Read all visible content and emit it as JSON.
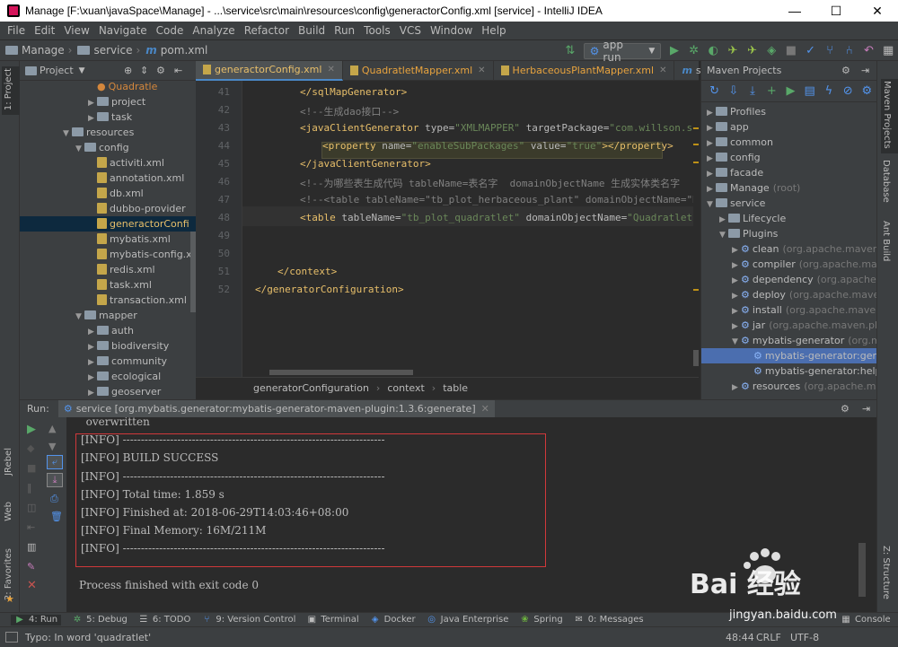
{
  "window": {
    "title": "Manage [F:\\xuan\\javaSpace\\Manage] - ...\\service\\src\\main\\resources\\config\\generactorConfig.xml [service] - IntelliJ IDEA",
    "minimize": "—",
    "maximize": "☐",
    "close": "✕"
  },
  "menu": [
    "File",
    "Edit",
    "View",
    "Navigate",
    "Code",
    "Analyze",
    "Refactor",
    "Build",
    "Run",
    "Tools",
    "VCS",
    "Window",
    "Help"
  ],
  "navbar": {
    "crumbs": [
      "Manage",
      "service",
      "pom.xml"
    ],
    "run_config": "app run"
  },
  "project_panel": {
    "title": "Project",
    "items": [
      {
        "label": "Quadratle",
        "type": "file-class"
      },
      {
        "label": "project",
        "type": "folder"
      },
      {
        "label": "task",
        "type": "folder"
      },
      {
        "label": "resources",
        "type": "folder"
      },
      {
        "label": "config",
        "type": "folder"
      },
      {
        "label": "activiti.xml",
        "type": "file"
      },
      {
        "label": "annotation.xml",
        "type": "file"
      },
      {
        "label": "db.xml",
        "type": "file"
      },
      {
        "label": "dubbo-provider",
        "type": "file"
      },
      {
        "label": "generactorConfi",
        "type": "file"
      },
      {
        "label": "mybatis.xml",
        "type": "file"
      },
      {
        "label": "mybatis-config.x",
        "type": "file"
      },
      {
        "label": "redis.xml",
        "type": "file"
      },
      {
        "label": "task.xml",
        "type": "file"
      },
      {
        "label": "transaction.xml",
        "type": "file"
      },
      {
        "label": "mapper",
        "type": "folder"
      },
      {
        "label": "auth",
        "type": "folder"
      },
      {
        "label": "biodiversity",
        "type": "folder"
      },
      {
        "label": "community",
        "type": "folder"
      },
      {
        "label": "ecological",
        "type": "folder"
      },
      {
        "label": "geoserver",
        "type": "folder"
      }
    ]
  },
  "left_strip": [
    "1: Project"
  ],
  "editor": {
    "tabs": [
      {
        "label": "generactorConfig.xml",
        "active": true
      },
      {
        "label": "QuadratletMapper.xml",
        "active": false
      },
      {
        "label": "HerbaceousPlantMapper.xml",
        "active": false
      },
      {
        "label": "service",
        "active": false
      }
    ],
    "line_numbers": [
      "41",
      "42",
      "43",
      "44",
      "45",
      "46",
      "47",
      "48",
      "49",
      "50",
      "51",
      "52"
    ],
    "lines": [
      {
        "indent": 2,
        "parts": [
          {
            "c": "tag",
            "t": "</sqlMapGenerator>"
          }
        ]
      },
      {
        "indent": 2,
        "parts": [
          {
            "c": "cmt",
            "t": "<!--生成dao接口-->"
          }
        ]
      },
      {
        "indent": 2,
        "parts": [
          {
            "c": "tag",
            "t": "<javaClientGenerator "
          },
          {
            "c": "attr",
            "t": "type="
          },
          {
            "c": "val",
            "t": "\"XMLMAPPER\" "
          },
          {
            "c": "attr",
            "t": "targetPackage="
          },
          {
            "c": "val",
            "t": "\"com.willson.serv"
          }
        ]
      },
      {
        "indent": 3,
        "parts": [
          {
            "c": "tag",
            "t": "<property "
          },
          {
            "c": "attr",
            "t": "name="
          },
          {
            "c": "val",
            "t": "\"enableSubPackages\" "
          },
          {
            "c": "attr",
            "t": "value="
          },
          {
            "c": "val",
            "t": "\"true\""
          },
          {
            "c": "tag",
            "t": "></property>"
          }
        ]
      },
      {
        "indent": 2,
        "parts": [
          {
            "c": "tag",
            "t": "</javaClientGenerator>"
          }
        ]
      },
      {
        "indent": 2,
        "parts": [
          {
            "c": "cmt",
            "t": "<!--为哪些表生成代码 tableName=表名字  domainObjectName 生成实体类名字"
          }
        ]
      },
      {
        "indent": 2,
        "parts": [
          {
            "c": "cmt",
            "t": "<!--<table tableName=\"tb_plot_herbaceous_plant\" domainObjectName=\"Her"
          }
        ]
      },
      {
        "indent": 2,
        "parts": [
          {
            "c": "tag",
            "t": "<table "
          },
          {
            "c": "attr",
            "t": "tableName="
          },
          {
            "c": "val",
            "t": "\"tb_plot_quadratlet\" "
          },
          {
            "c": "attr",
            "t": "domainObjectName="
          },
          {
            "c": "val",
            "t": "\"Quadratlet\" "
          },
          {
            "c": "tag",
            "t": "/"
          }
        ]
      },
      {
        "indent": 0,
        "parts": []
      },
      {
        "indent": 0,
        "parts": []
      },
      {
        "indent": 1,
        "parts": [
          {
            "c": "tag",
            "t": "</context>"
          }
        ]
      },
      {
        "indent": 0,
        "parts": [
          {
            "c": "tag",
            "t": "</generatorConfiguration>"
          }
        ]
      }
    ],
    "breadcrumbs": [
      "generatorConfiguration",
      "context",
      "table"
    ]
  },
  "maven_panel": {
    "title": "Maven Projects",
    "items": [
      {
        "label": "Profiles",
        "sub": "",
        "depth": 0,
        "open": false,
        "selected": false
      },
      {
        "label": "app",
        "sub": "",
        "depth": 0,
        "open": false,
        "selected": false
      },
      {
        "label": "common",
        "sub": "",
        "depth": 0,
        "open": false,
        "selected": false
      },
      {
        "label": "config",
        "sub": "",
        "depth": 0,
        "open": false,
        "selected": false
      },
      {
        "label": "facade",
        "sub": "",
        "depth": 0,
        "open": false,
        "selected": false
      },
      {
        "label": "Manage",
        "sub": "(root)",
        "depth": 0,
        "open": false,
        "selected": false
      },
      {
        "label": "service",
        "sub": "",
        "depth": 0,
        "open": true,
        "selected": false
      },
      {
        "label": "Lifecycle",
        "sub": "",
        "depth": 1,
        "open": false,
        "selected": false
      },
      {
        "label": "Plugins",
        "sub": "",
        "depth": 1,
        "open": true,
        "selected": false
      },
      {
        "label": "clean",
        "sub": "(org.apache.maven.plugi",
        "depth": 2,
        "open": false,
        "selected": false
      },
      {
        "label": "compiler",
        "sub": "(org.apache.maven.",
        "depth": 2,
        "open": false,
        "selected": false
      },
      {
        "label": "dependency",
        "sub": "(org.apache.mav",
        "depth": 2,
        "open": false,
        "selected": false
      },
      {
        "label": "deploy",
        "sub": "(org.apache.maven.pl",
        "depth": 2,
        "open": false,
        "selected": false
      },
      {
        "label": "install",
        "sub": "(org.apache.maven.pl",
        "depth": 2,
        "open": false,
        "selected": false
      },
      {
        "label": "jar",
        "sub": "(org.apache.maven.plugin",
        "depth": 2,
        "open": false,
        "selected": false
      },
      {
        "label": "mybatis-generator",
        "sub": "(org.myba",
        "depth": 2,
        "open": true,
        "selected": false
      },
      {
        "label": "mybatis-generator:genera",
        "sub": "",
        "depth": 3,
        "open": false,
        "selected": true
      },
      {
        "label": "mybatis-generator:help",
        "sub": "",
        "depth": 3,
        "open": false,
        "selected": false
      },
      {
        "label": "resources",
        "sub": "(org.apache.maven",
        "depth": 2,
        "open": false,
        "selected": false
      }
    ]
  },
  "right_strip": [
    "Maven Projects",
    "Database",
    "Ant Build"
  ],
  "run_panel": {
    "label": "Run:",
    "tab": "service [org.mybatis.generator:mybatis-generator-maven-plugin:1.3.6:generate]",
    "console": [
      "  overwritten",
      "[INFO] ------------------------------------------------------------------------",
      "[INFO] BUILD SUCCESS",
      "[INFO] ------------------------------------------------------------------------",
      "[INFO] Total time: 1.859 s",
      "[INFO] Finished at: 2018-06-29T14:03:46+08:00",
      "[INFO] Final Memory: 16M/211M",
      "[INFO] ------------------------------------------------------------------------",
      "",
      "Process finished with exit code 0"
    ]
  },
  "left_lower_strip": [
    "JRebel",
    "Web",
    "2: Favorites"
  ],
  "right_lower_strip": [
    "Z: Structure"
  ],
  "tool_windows": [
    "4: Run",
    "5: Debug",
    "6: TODO",
    "9: Version Control",
    "Terminal",
    "Docker",
    "Java Enterprise",
    "Spring",
    "0: Messages",
    "Console"
  ],
  "status": {
    "message": "Typo: In word 'quadratlet'",
    "position": "48:44",
    "line_sep": "CRLF",
    "encoding": "UTF-8"
  },
  "watermark": {
    "logo": "Bai 经验",
    "url": "jingyan.baidu.com"
  },
  "colors": {
    "accent": "#4a88c7",
    "highlight_box": "#d0383a",
    "run_green": "#59a869"
  }
}
